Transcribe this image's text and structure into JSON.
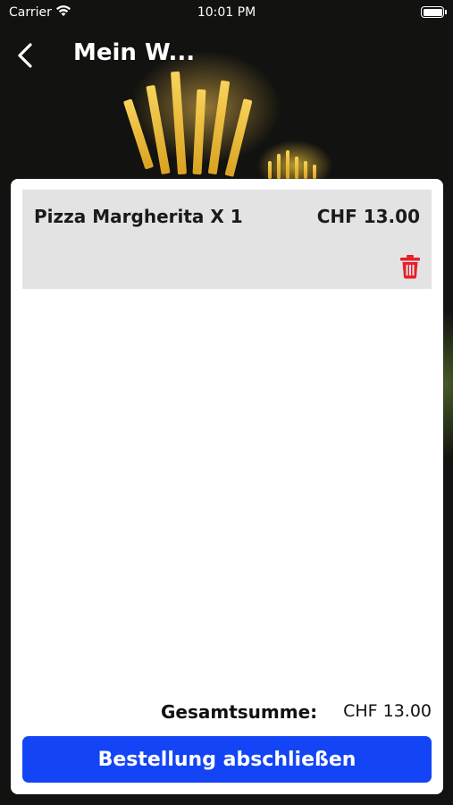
{
  "status_bar": {
    "carrier": "Carrier",
    "time": "10:01 PM"
  },
  "nav": {
    "title": "Mein W..."
  },
  "cart": {
    "items": [
      {
        "name": "Pizza Margherita X 1",
        "price": "CHF 13.00"
      }
    ],
    "total_label": "Gesamtsumme:",
    "total_value": "CHF 13.00",
    "checkout_label": "Bestellung abschließen"
  },
  "colors": {
    "accent": "#1344f5",
    "delete": "#e8202a",
    "item_bg": "#e3e3e3"
  }
}
